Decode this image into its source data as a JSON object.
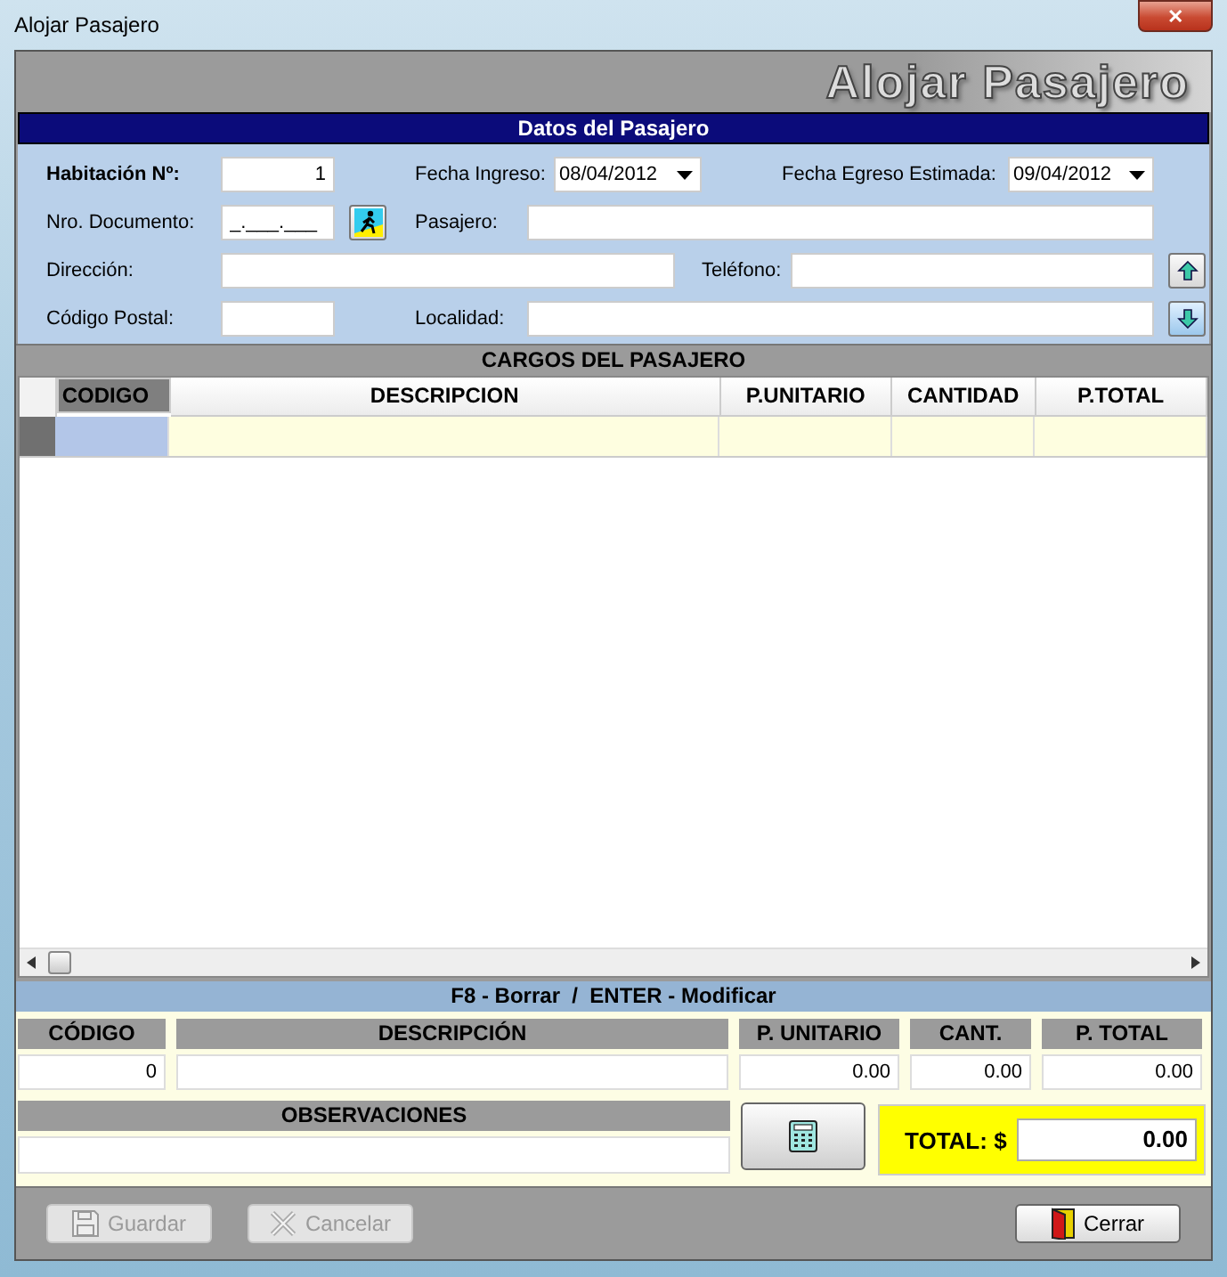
{
  "window": {
    "title": "Alojar Pasajero",
    "close": "✕"
  },
  "banner": "Alojar Pasajero",
  "passenger_section": {
    "title": "Datos del Pasajero",
    "room": {
      "label": "Habitación Nº:",
      "value": "1"
    },
    "check_in": {
      "label": "Fecha Ingreso:",
      "value": "08/04/2012"
    },
    "check_out": {
      "label": "Fecha Egreso Estimada:",
      "value": "09/04/2012"
    },
    "document": {
      "label": "Nro. Documento:",
      "value": "_.___.___"
    },
    "passenger": {
      "label": "Pasajero:"
    },
    "address": {
      "label": "Dirección:"
    },
    "phone": {
      "label": "Teléfono:"
    },
    "postal_code": {
      "label": "Código Postal:"
    },
    "locality": {
      "label": "Localidad:"
    }
  },
  "charges": {
    "title": "CARGOS DEL PASAJERO",
    "columns": [
      {
        "label": "CODIGO",
        "selected": true
      },
      {
        "label": "DESCRIPCION",
        "selected": false
      },
      {
        "label": "P.UNITARIO",
        "selected": false
      },
      {
        "label": "CANTIDAD",
        "selected": false
      },
      {
        "label": "P.TOTAL",
        "selected": false
      }
    ],
    "rows": [
      {
        "current": true
      }
    ]
  },
  "hint": "F8 - Borrar  /  ENTER - Modificar",
  "entry": {
    "columns": [
      {
        "label": "CÓDIGO",
        "value": "0"
      },
      {
        "label": "DESCRIPCIÓN"
      },
      {
        "label": "P. UNITARIO",
        "value": "0.00"
      },
      {
        "label": "CANT.",
        "value": "0.00"
      },
      {
        "label": "P. TOTAL",
        "value": "0.00"
      }
    ],
    "observations_label": "OBSERVACIONES",
    "total_label": "TOTAL: $",
    "total": "0.00"
  },
  "buttons": [
    {
      "kind": "save",
      "label": "Guardar",
      "disabled": true
    },
    {
      "kind": "cancel",
      "label": "Cancelar",
      "disabled": true
    },
    {
      "kind": "close",
      "label": "Cerrar",
      "disabled": false
    }
  ]
}
